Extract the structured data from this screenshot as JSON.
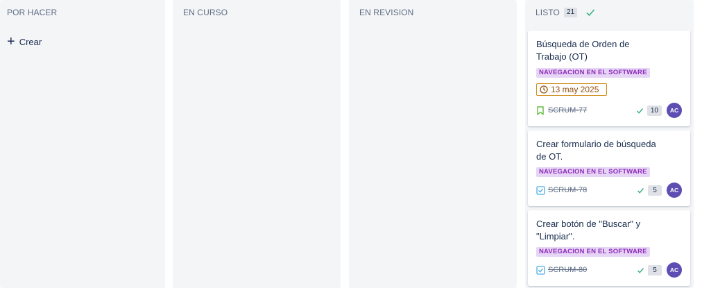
{
  "columns": [
    {
      "title": "POR HACER"
    },
    {
      "title": "EN CURSO"
    },
    {
      "title": "EN REVISION"
    },
    {
      "title": "LISTO",
      "count": "21"
    }
  ],
  "create_label": "Crear",
  "cards": [
    {
      "title": "Búsqueda de Orden de Trabajo (OT)",
      "label": "NAVEGACION EN EL SOFTWARE",
      "due_date": "13 may 2025",
      "type_icon": "bookmark-icon",
      "key": "SCRUM-77",
      "points": "10",
      "avatar": "AC"
    },
    {
      "title": "Crear formulario de búsqueda de OT.",
      "label": "NAVEGACION EN EL SOFTWARE",
      "type_icon": "checkbox-icon",
      "key": "SCRUM-78",
      "points": "5",
      "avatar": "AC"
    },
    {
      "title": "Crear botón de \"Buscar\" y \"Limpiar\".",
      "label": "NAVEGACION EN EL SOFTWARE",
      "type_icon": "checkbox-icon",
      "key": "SCRUM-80",
      "points": "5",
      "avatar": "AC"
    }
  ],
  "colors": {
    "column_bg": "#f4f5f7",
    "label_bg": "#e6d5f5",
    "label_text": "#8f2cbd",
    "due_border": "#d08a15",
    "check": "#36b37e",
    "avatar_bg": "#5e4db2",
    "story_icon": "#63ba3c",
    "task_icon": "#4bade8"
  }
}
